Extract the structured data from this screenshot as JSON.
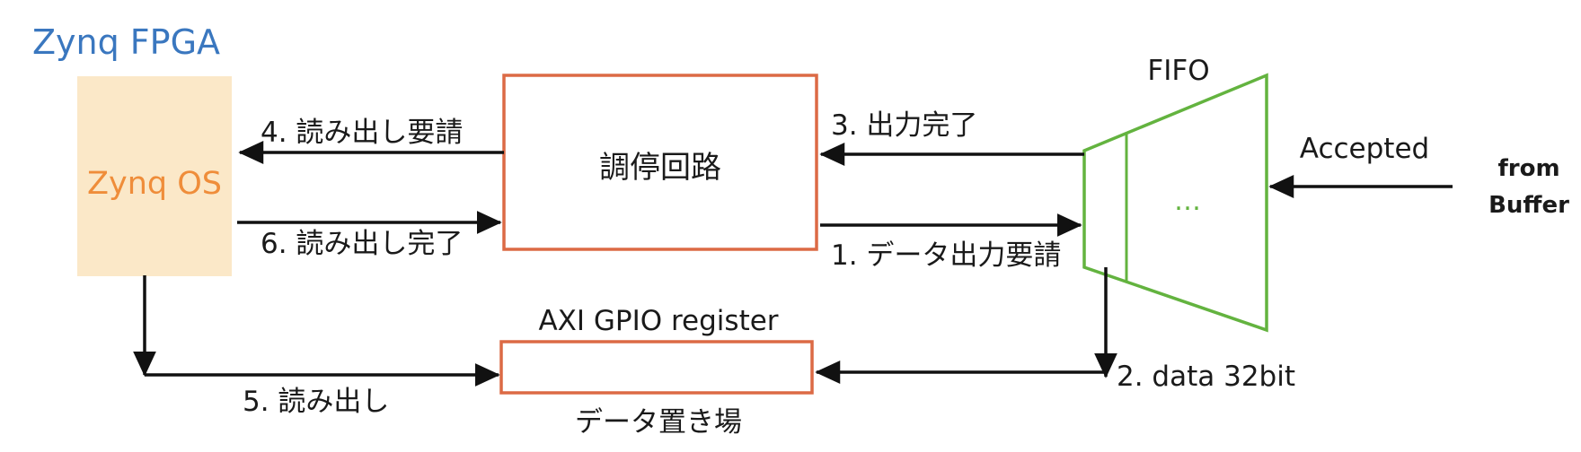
{
  "title": "Zynq FPGA",
  "zynq_os": "Zynq OS",
  "arbiter": "調停回路",
  "fifo": {
    "title": "FIFO",
    "ellipsis": "…"
  },
  "gpio": {
    "title": "AXI GPIO register",
    "caption": "データ置き場"
  },
  "source": {
    "line1": "from",
    "line2": "Buffer"
  },
  "arrows": {
    "accepted": "Accepted",
    "step1": "1. データ出力要請",
    "step2": "2. data 32bit",
    "step3": "3. 出力完了",
    "step4": "4. 読み出し要請",
    "step5": "5. 読み出し",
    "step6": "6. 読み出し完了"
  },
  "colors": {
    "zynq_title": "#3a77bf",
    "zynq_os_text": "#ef8d3a",
    "zynq_os_fill": "#fbe8c8",
    "arbiter_border": "#dc6a45",
    "gpio_border": "#dc6a45",
    "fifo_stroke": "#63b33f",
    "arrow": "#111111"
  }
}
